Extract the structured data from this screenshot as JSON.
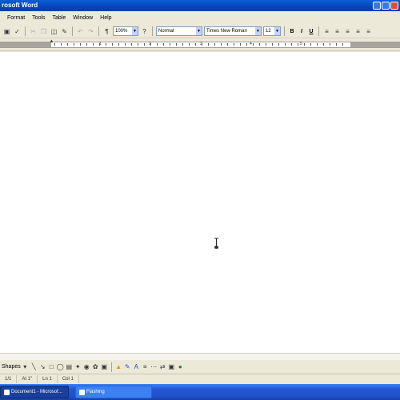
{
  "window": {
    "title": "rosoft Word"
  },
  "menu": {
    "items": [
      "Format",
      "Tools",
      "Table",
      "Window",
      "Help"
    ]
  },
  "toolbar": {
    "zoom": "100%",
    "style": "Normal",
    "font": "Times New Roman",
    "size": "12"
  },
  "ruler": {
    "numbers": [
      "1",
      "2",
      "3",
      "4",
      "5"
    ]
  },
  "drawing": {
    "autoshapes_label": "Shapes"
  },
  "status": {
    "page": "1/1",
    "at": "At 1\"",
    "ln": "Ln 1",
    "col": "Col 1"
  },
  "taskbar": {
    "task_active": "Document1 - Microsof...",
    "task_other": "Flashing"
  }
}
